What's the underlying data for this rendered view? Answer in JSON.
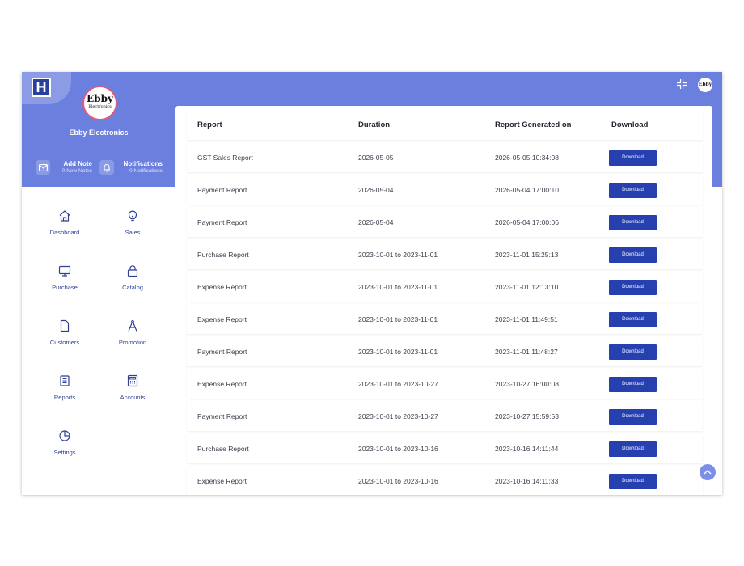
{
  "brand": {
    "logo_letter": "H",
    "avatar_line1": "Ebby",
    "avatar_line2": "Electronics",
    "name": "Ebby Electronics",
    "top_avatar_text": "Ebby"
  },
  "quick_actions": {
    "add_note": {
      "title": "Add Note",
      "subtitle": "0 New Notes",
      "icon": "note-icon"
    },
    "notifications": {
      "title": "Notifications",
      "subtitle": "0 Notifications",
      "icon": "bell-icon"
    }
  },
  "nav": [
    {
      "label": "Dashboard",
      "icon": "home-icon"
    },
    {
      "label": "Sales",
      "icon": "lightbulb-icon"
    },
    {
      "label": "Purchase",
      "icon": "monitor-icon"
    },
    {
      "label": "Catalog",
      "icon": "lock-icon"
    },
    {
      "label": "Customers",
      "icon": "file-icon"
    },
    {
      "label": "Promotion",
      "icon": "compass-icon"
    },
    {
      "label": "Reports",
      "icon": "report-icon"
    },
    {
      "label": "Accounts",
      "icon": "calculator-icon"
    },
    {
      "label": "Settings",
      "icon": "pie-chart-icon"
    }
  ],
  "table": {
    "headers": {
      "report": "Report",
      "duration": "Duration",
      "generated": "Report Generated on",
      "download": "Download"
    },
    "download_label": "Download",
    "rows": [
      {
        "report": "GST Sales Report",
        "duration": "2026-05-05",
        "generated": "2026-05-05 10:34:08"
      },
      {
        "report": "Payment Report",
        "duration": "2026-05-04",
        "generated": "2026-05-04 17:00:10"
      },
      {
        "report": "Payment Report",
        "duration": "2026-05-04",
        "generated": "2026-05-04 17:00:06"
      },
      {
        "report": "Purchase Report",
        "duration": "2023-10-01 to 2023-11-01",
        "generated": "2023-11-01 15:25:13"
      },
      {
        "report": "Expense Report",
        "duration": "2023-10-01 to 2023-11-01",
        "generated": "2023-11-01 12:13:10"
      },
      {
        "report": "Expense Report",
        "duration": "2023-10-01 to 2023-11-01",
        "generated": "2023-11-01 11:49:51"
      },
      {
        "report": "Payment Report",
        "duration": "2023-10-01 to 2023-11-01",
        "generated": "2023-11-01 11:48:27"
      },
      {
        "report": "Expense Report",
        "duration": "2023-10-01 to 2023-10-27",
        "generated": "2023-10-27 16:00:08"
      },
      {
        "report": "Payment Report",
        "duration": "2023-10-01 to 2023-10-27",
        "generated": "2023-10-27 15:59:53"
      },
      {
        "report": "Purchase Report",
        "duration": "2023-10-01 to 2023-10-16",
        "generated": "2023-10-16 14:11:44"
      },
      {
        "report": "Expense Report",
        "duration": "2023-10-01 to 2023-10-16",
        "generated": "2023-10-16 14:11:33"
      }
    ]
  },
  "colors": {
    "header_band": "#6a7fde",
    "accent": "#2740b0",
    "nav_text": "#2f3f93",
    "avatar_ring": "#e4587a"
  }
}
